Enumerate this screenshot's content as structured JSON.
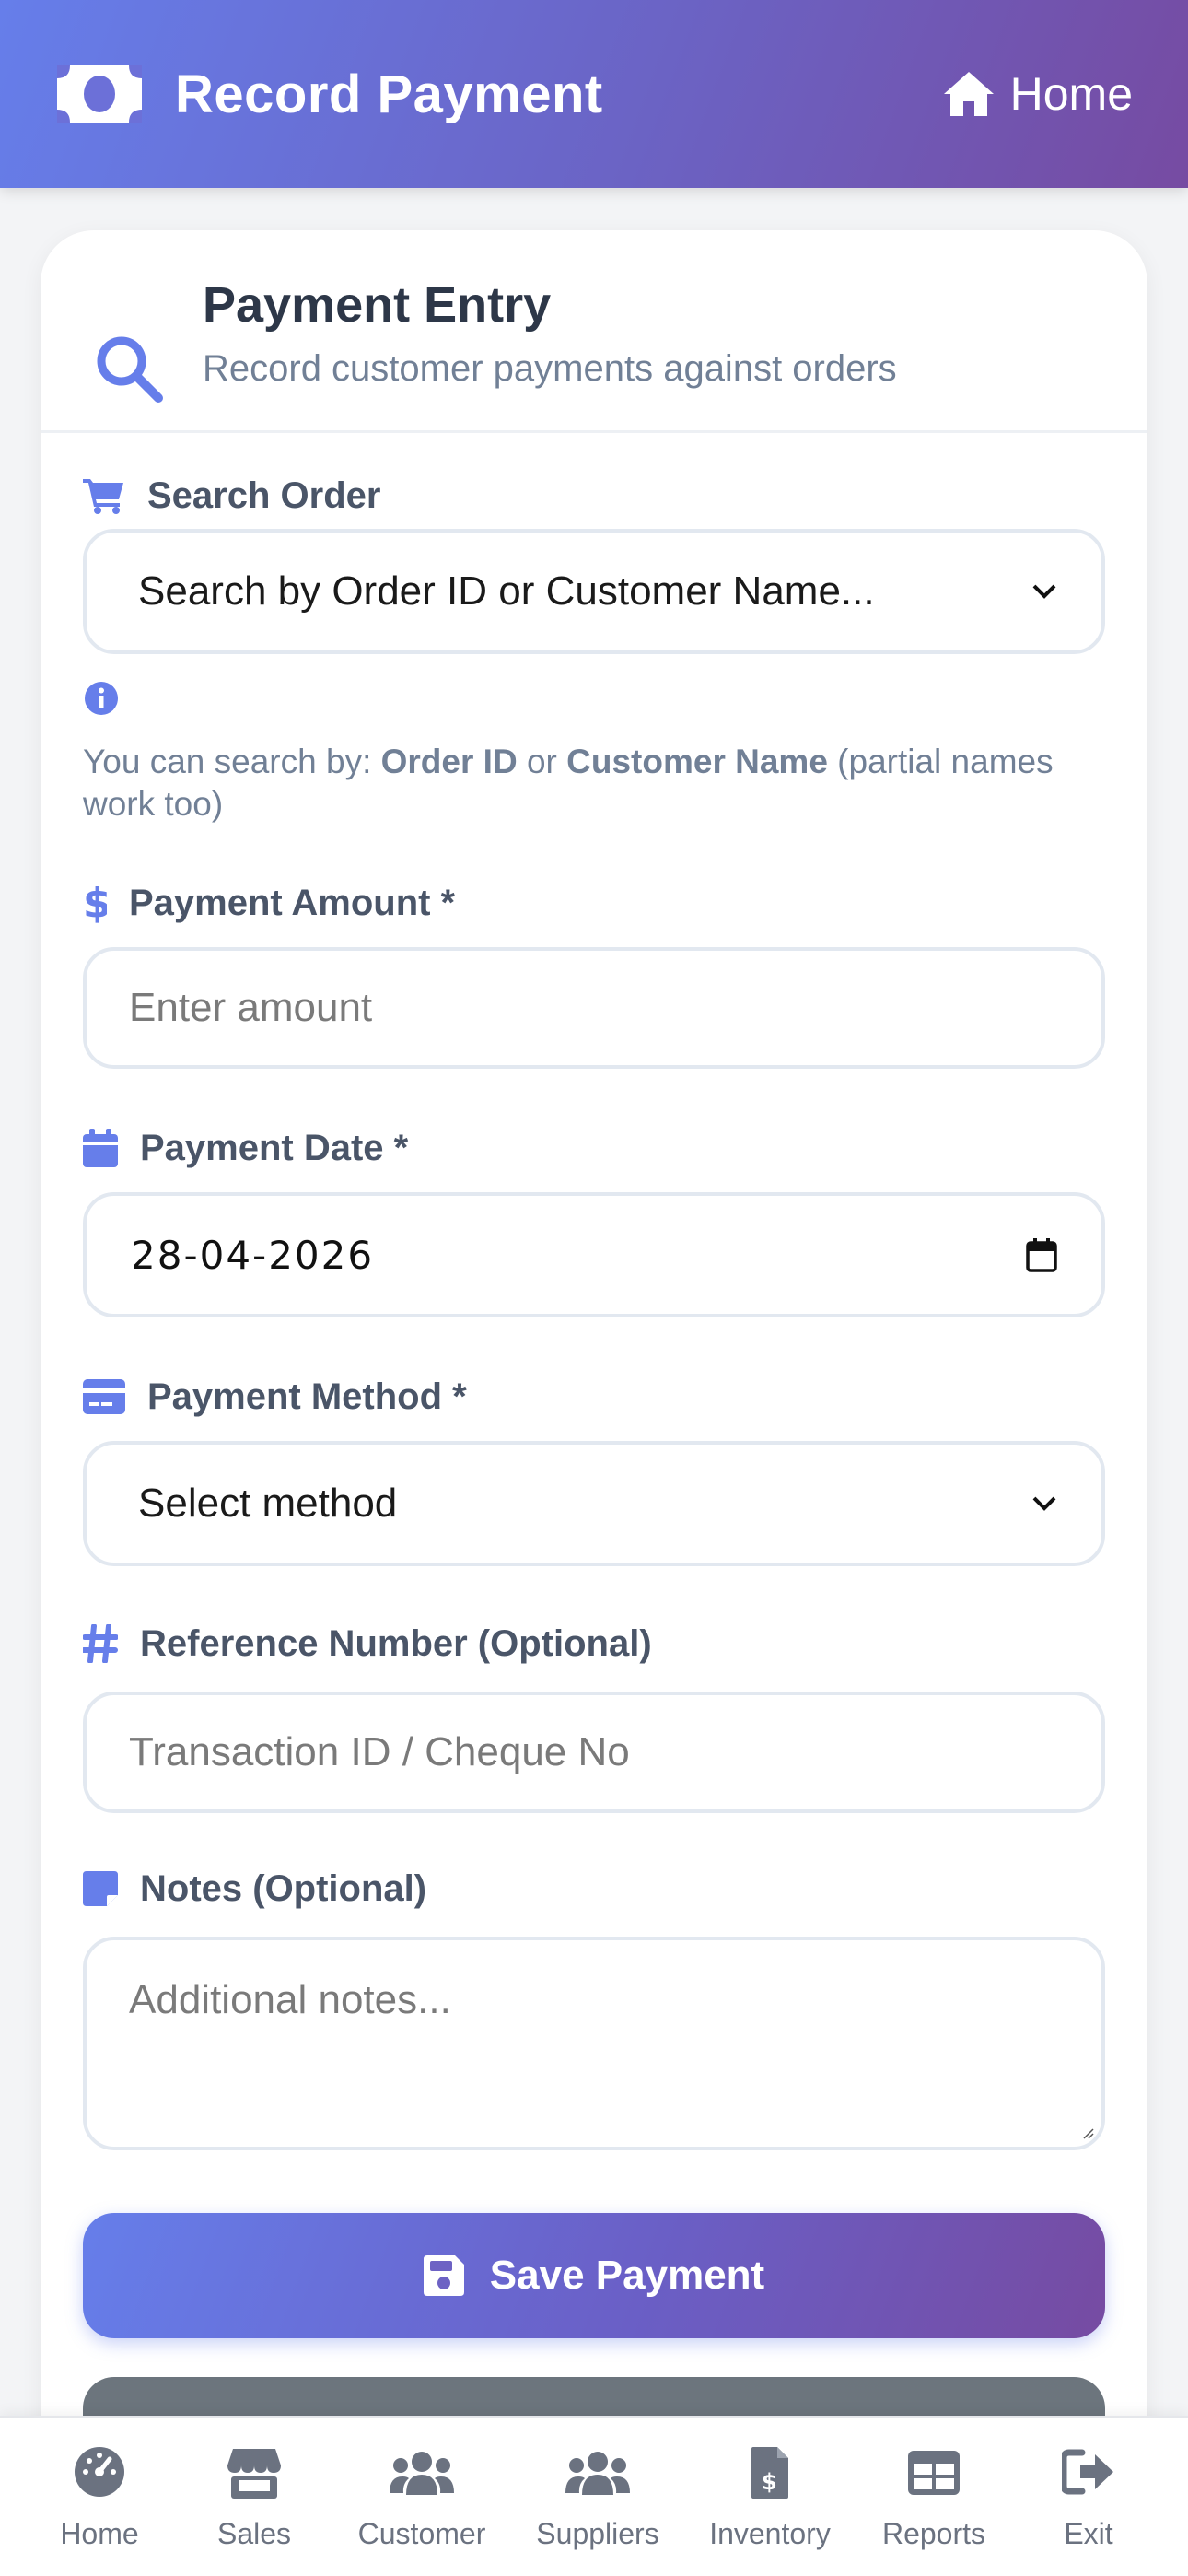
{
  "header": {
    "title": "Record Payment",
    "home_label": "Home",
    "brand_icon": "money-bill-icon",
    "home_icon": "home-icon",
    "gradient": [
      "#667eea",
      "#764ba2"
    ]
  },
  "card": {
    "title": "Payment Entry",
    "subtitle": "Record customer payments against orders",
    "icon": "search-icon"
  },
  "form": {
    "search_order": {
      "label": "Search Order",
      "icon": "cart-icon",
      "selected": "Search by Order ID or Customer Name..."
    },
    "hint": {
      "prefix": "You can search by: ",
      "term1": "Order ID",
      "middle": " or ",
      "term2": "Customer Name",
      "suffix": " (partial names work too)"
    },
    "amount": {
      "label": "Payment Amount *",
      "icon": "dollar-icon",
      "placeholder": "Enter amount"
    },
    "date": {
      "label": "Payment Date *",
      "icon": "calendar-icon",
      "value": "28-04-2026"
    },
    "method": {
      "label": "Payment Method *",
      "icon": "credit-card-icon",
      "selected": "Select method"
    },
    "reference": {
      "label": "Reference Number (Optional)",
      "icon": "hashtag-icon",
      "placeholder": "Transaction ID / Cheque No"
    },
    "notes": {
      "label": "Notes (Optional)",
      "icon": "sticky-note-icon",
      "placeholder": "Additional notes..."
    },
    "save_label": "Save Payment"
  },
  "nav": {
    "items": [
      {
        "label": "Home",
        "icon": "tachometer-icon"
      },
      {
        "label": "Sales",
        "icon": "store-icon"
      },
      {
        "label": "Customer",
        "icon": "users-icon"
      },
      {
        "label": "Suppliers",
        "icon": "users-icon"
      },
      {
        "label": "Inventory",
        "icon": "invoice-dollar-icon"
      },
      {
        "label": "Reports",
        "icon": "table-icon"
      },
      {
        "label": "Exit",
        "icon": "sign-out-icon"
      }
    ]
  },
  "colors": {
    "accent": "#667eea",
    "accent_end": "#764ba2",
    "label": "#4a5568",
    "muted": "#718096",
    "secondary_button": "#6c757d"
  }
}
